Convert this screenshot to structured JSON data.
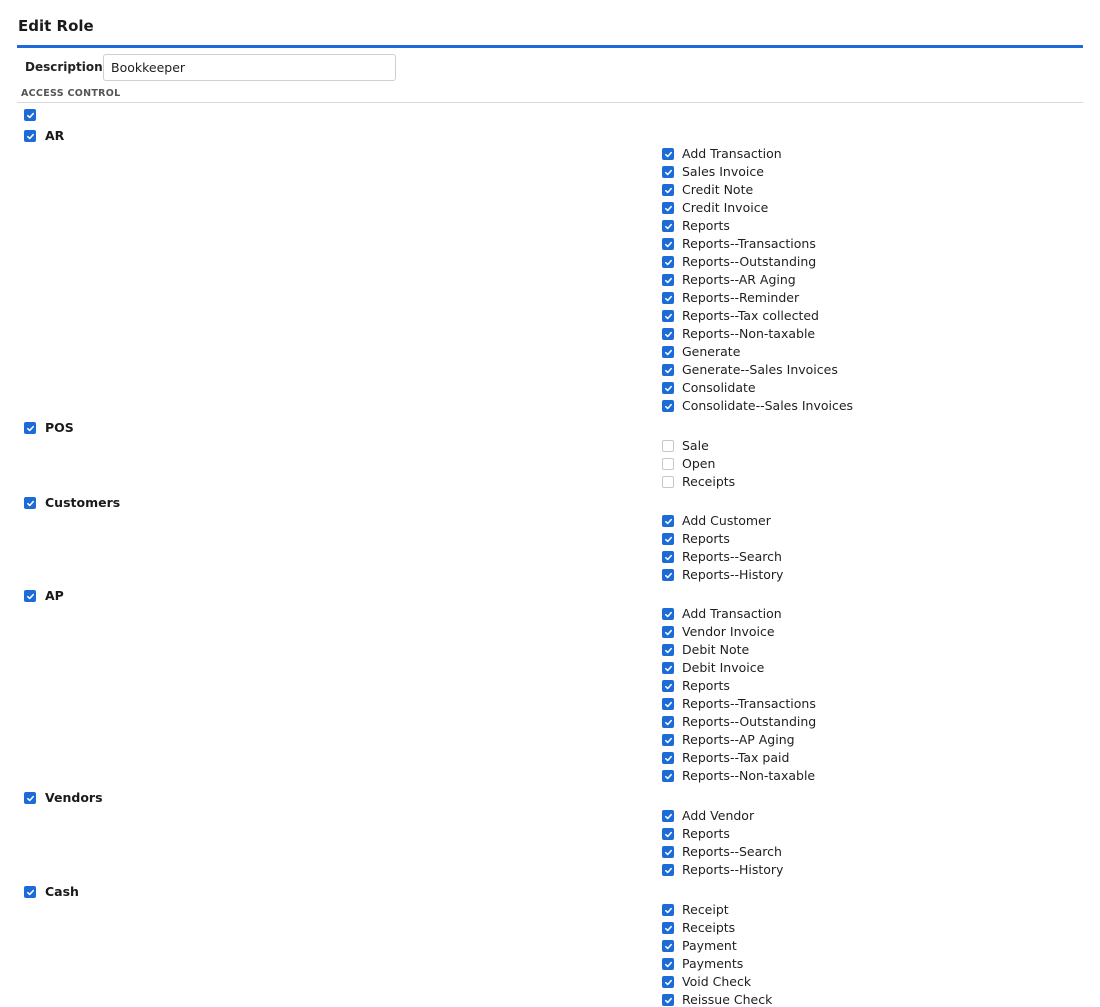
{
  "page": {
    "title": "Edit Role"
  },
  "form": {
    "description_label": "Description",
    "description_value": "Bookkeeper",
    "section_title": "ACCESS CONTROL"
  },
  "colors": {
    "accent": "#1c6bd6",
    "unchecked_border": "#c8c8c8"
  },
  "select_all_checked": true,
  "groups": [
    {
      "label": "AR",
      "checked": true,
      "items": [
        {
          "label": "Add Transaction",
          "checked": true
        },
        {
          "label": "Sales Invoice",
          "checked": true
        },
        {
          "label": "Credit Note",
          "checked": true
        },
        {
          "label": "Credit Invoice",
          "checked": true
        },
        {
          "label": "Reports",
          "checked": true
        },
        {
          "label": "Reports--Transactions",
          "checked": true
        },
        {
          "label": "Reports--Outstanding",
          "checked": true
        },
        {
          "label": "Reports--AR Aging",
          "checked": true
        },
        {
          "label": "Reports--Reminder",
          "checked": true
        },
        {
          "label": "Reports--Tax collected",
          "checked": true
        },
        {
          "label": "Reports--Non-taxable",
          "checked": true
        },
        {
          "label": "Generate",
          "checked": true
        },
        {
          "label": "Generate--Sales Invoices",
          "checked": true
        },
        {
          "label": "Consolidate",
          "checked": true
        },
        {
          "label": "Consolidate--Sales Invoices",
          "checked": true
        }
      ]
    },
    {
      "label": "POS",
      "checked": true,
      "items": [
        {
          "label": "Sale",
          "checked": false
        },
        {
          "label": "Open",
          "checked": false
        },
        {
          "label": "Receipts",
          "checked": false
        }
      ]
    },
    {
      "label": "Customers",
      "checked": true,
      "items": [
        {
          "label": "Add Customer",
          "checked": true
        },
        {
          "label": "Reports",
          "checked": true
        },
        {
          "label": "Reports--Search",
          "checked": true
        },
        {
          "label": "Reports--History",
          "checked": true
        }
      ]
    },
    {
      "label": "AP",
      "checked": true,
      "items": [
        {
          "label": "Add Transaction",
          "checked": true
        },
        {
          "label": "Vendor Invoice",
          "checked": true
        },
        {
          "label": "Debit Note",
          "checked": true
        },
        {
          "label": "Debit Invoice",
          "checked": true
        },
        {
          "label": "Reports",
          "checked": true
        },
        {
          "label": "Reports--Transactions",
          "checked": true
        },
        {
          "label": "Reports--Outstanding",
          "checked": true
        },
        {
          "label": "Reports--AP Aging",
          "checked": true
        },
        {
          "label": "Reports--Tax paid",
          "checked": true
        },
        {
          "label": "Reports--Non-taxable",
          "checked": true
        }
      ]
    },
    {
      "label": "Vendors",
      "checked": true,
      "items": [
        {
          "label": "Add Vendor",
          "checked": true
        },
        {
          "label": "Reports",
          "checked": true
        },
        {
          "label": "Reports--Search",
          "checked": true
        },
        {
          "label": "Reports--History",
          "checked": true
        }
      ]
    },
    {
      "label": "Cash",
      "checked": true,
      "items": [
        {
          "label": "Receipt",
          "checked": true
        },
        {
          "label": "Receipts",
          "checked": true
        },
        {
          "label": "Payment",
          "checked": true
        },
        {
          "label": "Payments",
          "checked": true
        },
        {
          "label": "Void Check",
          "checked": true
        },
        {
          "label": "Reissue Check",
          "checked": true
        }
      ]
    }
  ]
}
